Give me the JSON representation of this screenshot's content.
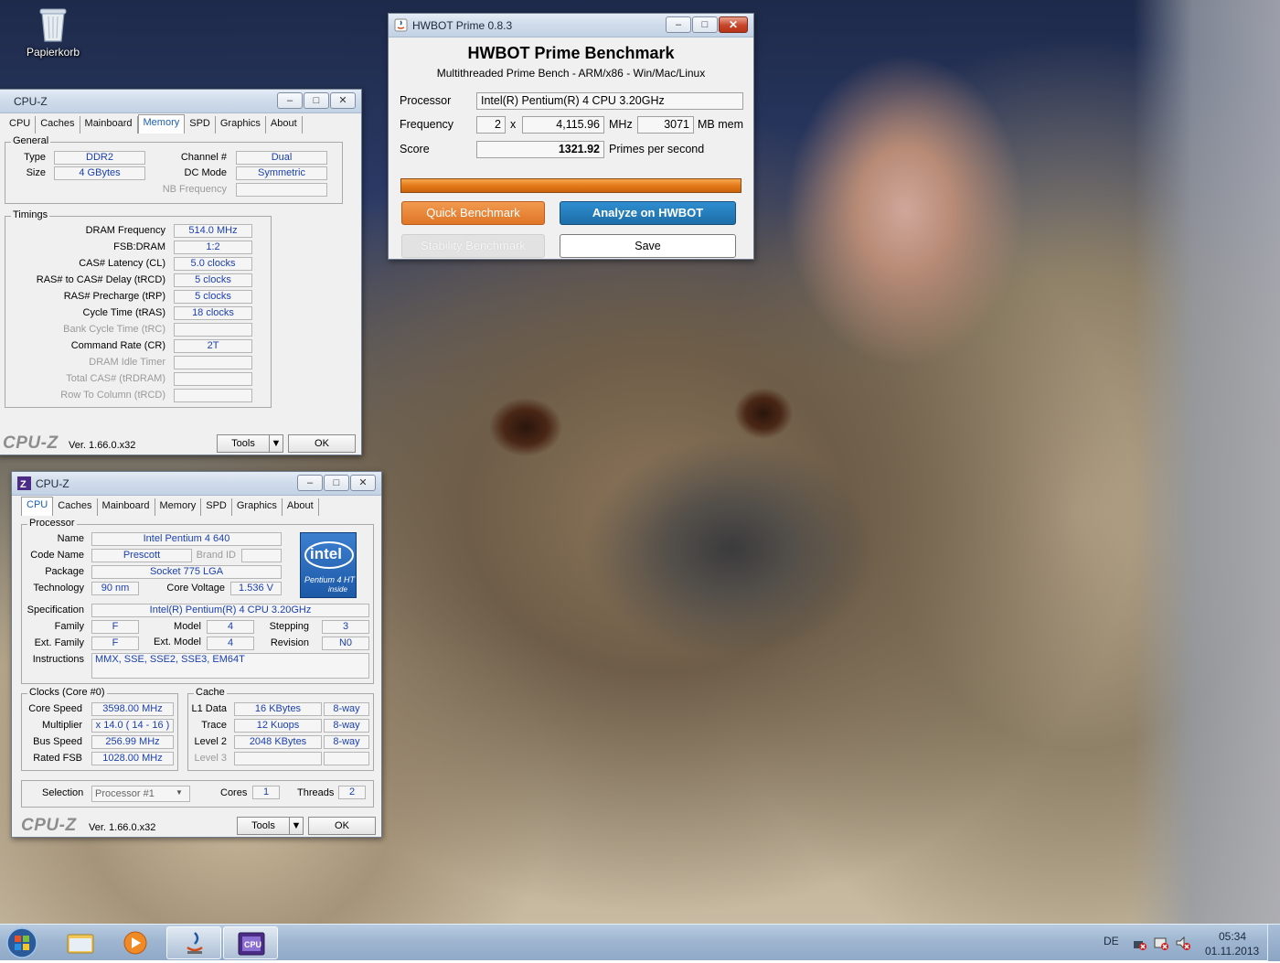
{
  "desktop": {
    "recycle_bin_label": "Papierkorb"
  },
  "hwbot": {
    "window_title": "HWBOT Prime 0.8.3",
    "heading": "HWBOT Prime Benchmark",
    "subheading": "Multithreaded Prime Bench - ARM/x86 - Win/Mac/Linux",
    "processor_label": "Processor",
    "processor_value": "Intel(R) Pentium(R) 4 CPU 3.20GHz",
    "frequency_label": "Frequency",
    "cores_value": "2",
    "times_sign": "x",
    "frequency_value": "4,115.96",
    "mhz_unit": "MHz",
    "memory_value": "3071",
    "mem_unit": "MB mem",
    "score_label": "Score",
    "score_value": "1321.92",
    "score_unit": "Primes per second",
    "progress_fraction": 1.0,
    "quick_benchmark": "Quick Benchmark",
    "analyze": "Analyze on HWBOT",
    "stability_benchmark": "Stability Benchmark",
    "save": "Save"
  },
  "cpuz_memory": {
    "window_title": "CPU-Z",
    "tabs": [
      "CPU",
      "Caches",
      "Mainboard",
      "Memory",
      "SPD",
      "Graphics",
      "About"
    ],
    "active_tab": "Memory",
    "general_title": "General",
    "type_label": "Type",
    "type_value": "DDR2",
    "size_label": "Size",
    "size_value": "4 GBytes",
    "channel_label": "Channel #",
    "channel_value": "Dual",
    "dcmode_label": "DC Mode",
    "dcmode_value": "Symmetric",
    "nbfreq_label": "NB Frequency",
    "nbfreq_value": "",
    "timings_title": "Timings",
    "timings": [
      {
        "label": "DRAM Frequency",
        "value": "514.0 MHz",
        "dim": false
      },
      {
        "label": "FSB:DRAM",
        "value": "1:2",
        "dim": false
      },
      {
        "label": "CAS# Latency (CL)",
        "value": "5.0 clocks",
        "dim": false
      },
      {
        "label": "RAS# to CAS# Delay (tRCD)",
        "value": "5 clocks",
        "dim": false
      },
      {
        "label": "RAS# Precharge (tRP)",
        "value": "5 clocks",
        "dim": false
      },
      {
        "label": "Cycle Time (tRAS)",
        "value": "18 clocks",
        "dim": false
      },
      {
        "label": "Bank Cycle Time (tRC)",
        "value": "",
        "dim": true
      },
      {
        "label": "Command Rate (CR)",
        "value": "2T",
        "dim": false
      },
      {
        "label": "DRAM Idle Timer",
        "value": "",
        "dim": true
      },
      {
        "label": "Total CAS# (tRDRAM)",
        "value": "",
        "dim": true
      },
      {
        "label": "Row To Column (tRCD)",
        "value": "",
        "dim": true
      }
    ],
    "brand": "CPU-Z",
    "version": "Ver. 1.66.0.x32",
    "tools": "Tools",
    "ok": "OK"
  },
  "cpuz_cpu": {
    "window_title": "CPU-Z",
    "tabs": [
      "CPU",
      "Caches",
      "Mainboard",
      "Memory",
      "SPD",
      "Graphics",
      "About"
    ],
    "active_tab": "CPU",
    "processor_title": "Processor",
    "name_label": "Name",
    "name_value": "Intel Pentium 4 640",
    "codename_label": "Code Name",
    "codename_value": "Prescott",
    "brandid_label": "Brand ID",
    "brandid_value": "",
    "package_label": "Package",
    "package_value": "Socket 775 LGA",
    "technology_label": "Technology",
    "technology_value": "90 nm",
    "corevoltage_label": "Core Voltage",
    "corevoltage_value": "1.536 V",
    "spec_label": "Specification",
    "spec_value": "Intel(R) Pentium(R) 4 CPU 3.20GHz",
    "family_label": "Family",
    "family_value": "F",
    "model_label": "Model",
    "model_value": "4",
    "stepping_label": "Stepping",
    "stepping_value": "3",
    "extfamily_label": "Ext. Family",
    "extfamily_value": "F",
    "extmodel_label": "Ext. Model",
    "extmodel_value": "4",
    "revision_label": "Revision",
    "revision_value": "N0",
    "instructions_label": "Instructions",
    "instructions_value": "MMX, SSE, SSE2, SSE3, EM64T",
    "intel_logo_text": "intel",
    "intel_logo_sub": "Pentium 4 HT",
    "intel_logo_inside": "inside",
    "clocks_title": "Clocks (Core #0)",
    "corespeed_label": "Core Speed",
    "corespeed_value": "3598.00 MHz",
    "multiplier_label": "Multiplier",
    "multiplier_value": "x 14.0 ( 14 - 16 )",
    "busspeed_label": "Bus Speed",
    "busspeed_value": "256.99 MHz",
    "ratedfsb_label": "Rated FSB",
    "ratedfsb_value": "1028.00 MHz",
    "cache_title": "Cache",
    "l1_label": "L1 Data",
    "l1_value": "16 KBytes",
    "l1_way": "8-way",
    "trace_label": "Trace",
    "trace_value": "12 Kuops",
    "trace_way": "8-way",
    "l2_label": "Level 2",
    "l2_value": "2048 KBytes",
    "l2_way": "8-way",
    "l3_label": "Level 3",
    "l3_value": "",
    "l3_way": "",
    "selection_label": "Selection",
    "selection_value": "Processor #1",
    "cores_label": "Cores",
    "cores_value": "1",
    "threads_label": "Threads",
    "threads_value": "2",
    "brand": "CPU-Z",
    "version": "Ver. 1.66.0.x32",
    "tools": "Tools",
    "ok": "OK"
  },
  "taskbar": {
    "language": "DE",
    "time": "05:34",
    "date": "01.11.2013"
  }
}
